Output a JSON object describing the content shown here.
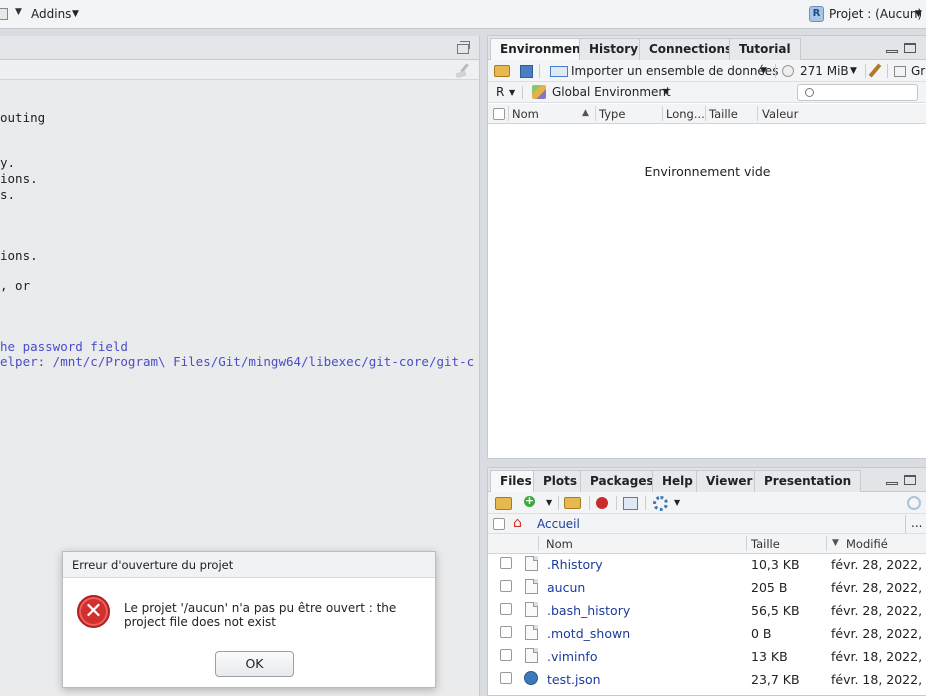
{
  "topbar": {
    "addins_label": "Addins",
    "project_label": "Projet : (Aucun)"
  },
  "console": {
    "lines": [
      "outing",
      "y.",
      "ions.",
      "s.",
      "ions.",
      ", or",
      "he password field",
      "elper: /mnt/c/Program\\ Files/Git/mingw64/libexec/git-core/git-c"
    ]
  },
  "env_pane": {
    "tabs": [
      "Environment",
      "History",
      "Connections",
      "Tutorial"
    ],
    "active_tab": "Environment",
    "import_label": "Importer un ensemble de données",
    "memory_label": "271 MiB",
    "grid_label": "Gri",
    "language_select": "R",
    "scope_select": "Global Environment",
    "search_placeholder": "",
    "columns": [
      "Nom",
      "Type",
      "Long...",
      "Taille",
      "Valeur"
    ],
    "empty_message": "Environnement vide"
  },
  "files_pane": {
    "tabs": [
      "Files",
      "Plots",
      "Packages",
      "Help",
      "Viewer",
      "Presentation"
    ],
    "active_tab": "Files",
    "breadcrumb_home": "Accueil",
    "more_label": "...",
    "columns": [
      "Nom",
      "Taille",
      "Modifié"
    ],
    "rows": [
      {
        "name": ".Rhistory",
        "size": "10,3 KB",
        "modified": "févr. 28, 2022,",
        "icon": "history-file-icon"
      },
      {
        "name": "aucun",
        "size": "205 B",
        "modified": "févr. 28, 2022,",
        "icon": "file-icon"
      },
      {
        "name": ".bash_history",
        "size": "56,5 KB",
        "modified": "févr. 28, 2022,",
        "icon": "file-icon"
      },
      {
        "name": ".motd_shown",
        "size": "0 B",
        "modified": "févr. 28, 2022,",
        "icon": "file-icon"
      },
      {
        "name": ".viminfo",
        "size": "13 KB",
        "modified": "févr. 18, 2022,",
        "icon": "file-icon"
      },
      {
        "name": "test.json",
        "size": "23,7 KB",
        "modified": "févr. 18, 2022,",
        "icon": "json-file-icon"
      }
    ]
  },
  "dialog": {
    "title": "Erreur d'ouverture du projet",
    "message": "Le projet '/aucun' n'a pas pu être ouvert : the project file does not exist",
    "ok_label": "OK"
  }
}
